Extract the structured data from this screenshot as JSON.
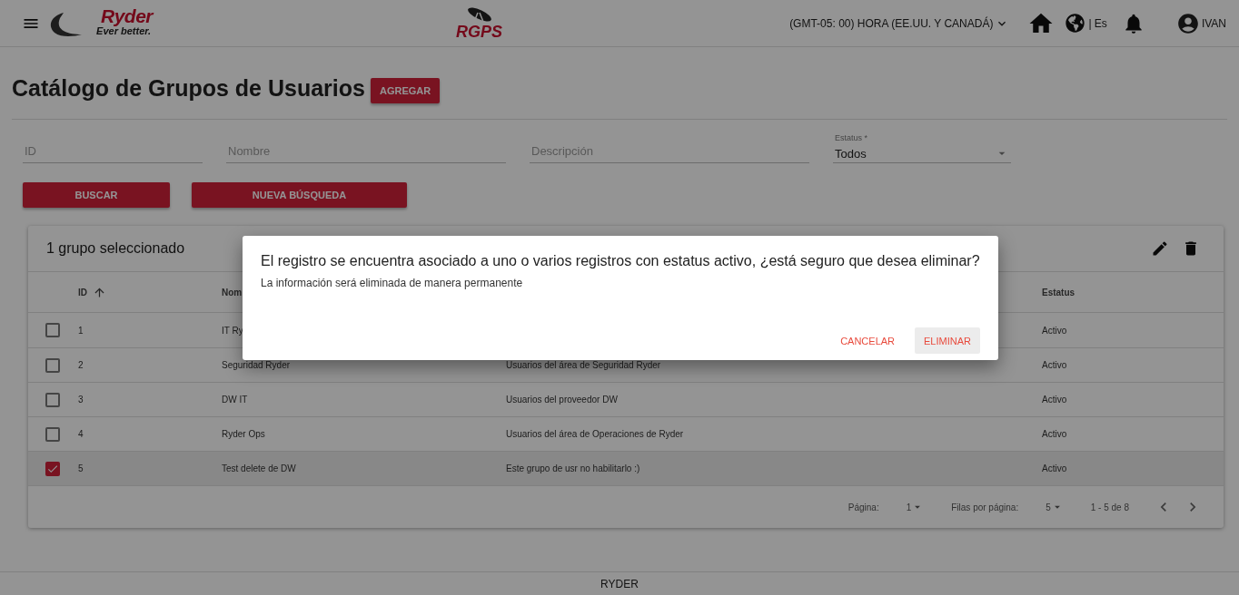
{
  "header": {
    "logo": {
      "name": "Ryder",
      "tagline": "Ever better."
    },
    "app_logo": "RGPS",
    "timezone": "(GMT-05: 00) HORA (EE.UU. Y CANADÁ)",
    "language": "| Es",
    "user": "IVAN"
  },
  "page": {
    "title": "Catálogo de Grupos de Usuarios",
    "add_button": "AGREGAR"
  },
  "filters": [
    {
      "placeholder": "ID"
    },
    {
      "placeholder": "Nombre"
    },
    {
      "placeholder": "Descripción"
    }
  ],
  "status_filter": {
    "label": "Estatus *",
    "value": "Todos"
  },
  "buttons": [
    "BUSCAR",
    "NUEVA BÚSQUEDA"
  ],
  "table": {
    "selection_title": "1 grupo seleccionado",
    "columns": [
      {
        "label": "ID",
        "sorted": true
      },
      {
        "label": "Nom",
        "sorted": false
      },
      {
        "label": "Estatus",
        "sorted": false
      }
    ],
    "rows": [
      {
        "id": "1",
        "name": "IT Ry",
        "status": "Activo",
        "checked": false
      },
      {
        "id": "2",
        "name": "Seguridad Ryder",
        "description": "Usuarios del área de Seguridad Ryder",
        "status": "Activo",
        "checked": false
      },
      {
        "id": "3",
        "name": "DW IT",
        "description": "Usuarios del proveedor DW",
        "status": "Activo",
        "checked": false
      },
      {
        "id": "4",
        "name": "Ryder Ops",
        "description": "Usuarios del área de Operaciones de Ryder",
        "status": "Activo",
        "checked": false
      },
      {
        "id": "5",
        "name": "Test delete de DW",
        "description": "Este grupo de usr no habilitarlo :)",
        "status": "Activo",
        "checked": true
      }
    ],
    "pagination": {
      "page_label": "Página:",
      "page": "1",
      "rows_label": "Filas por página:",
      "rows": "5",
      "range": "1 - 5 de 8"
    }
  },
  "dialog": {
    "title": "El registro se encuentra asociado a uno o varios registros con estatus activo, ¿está seguro que desea eliminar?",
    "message": "La información será eliminada de manera permanente",
    "buttons": [
      {
        "label": "CANCELAR",
        "kind": "text"
      },
      {
        "label": "ELIMINAR",
        "kind": "filled"
      }
    ]
  },
  "footer": "RYDER"
}
